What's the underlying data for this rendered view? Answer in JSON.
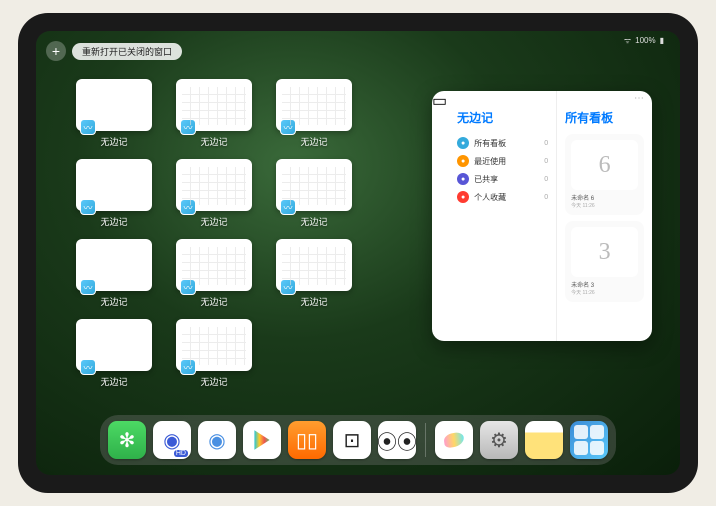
{
  "status": {
    "battery": "100%",
    "signal": "●●●"
  },
  "topbar": {
    "plus_label": "+",
    "reopen_label": "重新打开已关闭的窗口"
  },
  "windows": {
    "app_label": "无边记",
    "items": [
      {
        "kind": "blank"
      },
      {
        "kind": "calendar"
      },
      {
        "kind": "calendar"
      },
      {
        "kind": "blank"
      },
      {
        "kind": "calendar"
      },
      {
        "kind": "calendar"
      },
      {
        "kind": "blank"
      },
      {
        "kind": "calendar"
      },
      {
        "kind": "calendar"
      },
      {
        "kind": "blank"
      },
      {
        "kind": "calendar"
      }
    ]
  },
  "panel": {
    "app_title": "无边记",
    "sidebar": [
      {
        "icon": "blue",
        "label": "所有看板",
        "count": 0
      },
      {
        "icon": "orange",
        "label": "最近使用",
        "count": 0
      },
      {
        "icon": "indigo",
        "label": "已共享",
        "count": 0
      },
      {
        "icon": "red",
        "label": "个人收藏",
        "count": 0
      }
    ],
    "right_title": "所有看板",
    "boards": [
      {
        "glyph": "6",
        "name": "未命名 6",
        "time": "今天 11:26"
      },
      {
        "glyph": "3",
        "name": "未命名 3",
        "time": "今天 11:26"
      }
    ]
  },
  "dock": {
    "apps": [
      {
        "name": "wechat-icon",
        "glyph": "✻"
      },
      {
        "name": "quark-hd-icon",
        "glyph": "◉",
        "badge": "HD"
      },
      {
        "name": "quark-icon",
        "glyph": "◉"
      },
      {
        "name": "play-icon"
      },
      {
        "name": "books-icon",
        "glyph": "▯▯"
      },
      {
        "name": "dice-icon",
        "glyph": "⊡"
      },
      {
        "name": "connect-icon",
        "glyph": "⦿⦿"
      },
      {
        "name": "freeform-icon"
      },
      {
        "name": "settings-icon",
        "glyph": "⚙"
      },
      {
        "name": "notes-icon",
        "glyph": ""
      },
      {
        "name": "app-library-icon"
      }
    ]
  }
}
